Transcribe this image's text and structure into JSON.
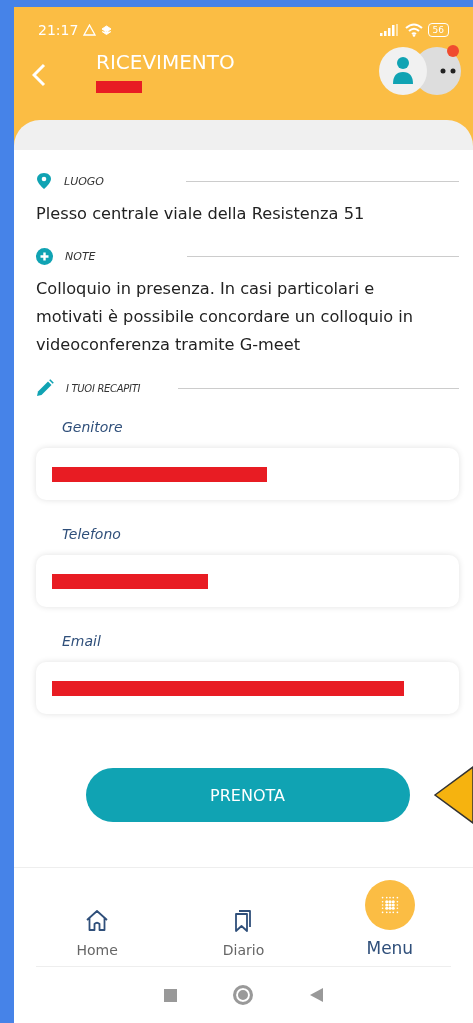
{
  "status_bar": {
    "time": "21:17",
    "battery": "56"
  },
  "header": {
    "title": "RICEVIMENTO",
    "subtitle_redacted": true,
    "notification": true
  },
  "sections": [
    {
      "kind": "place",
      "label": "LUOGO",
      "text": "Plesso centrale viale della Resistenza 51"
    },
    {
      "kind": "note",
      "label": "NOTE",
      "text": "Colloquio in presenza. In casi particolari e motivati è possibile concordare un colloquio in videoconferenza tramite G-meet"
    },
    {
      "kind": "edit",
      "label": "I TUOI RECAPITI"
    }
  ],
  "fields": [
    {
      "label": "Genitore",
      "redacted": true
    },
    {
      "label": "Telefono",
      "redacted": true
    },
    {
      "label": "Email",
      "redacted": true
    }
  ],
  "button": {
    "label": "PRENOTA",
    "pointer": true
  },
  "nav": [
    {
      "kind": "home",
      "label": "Home",
      "selected": false
    },
    {
      "kind": "diary",
      "label": "Diario",
      "selected": false
    },
    {
      "kind": "menu",
      "label": "Menu",
      "selected": true
    }
  ]
}
